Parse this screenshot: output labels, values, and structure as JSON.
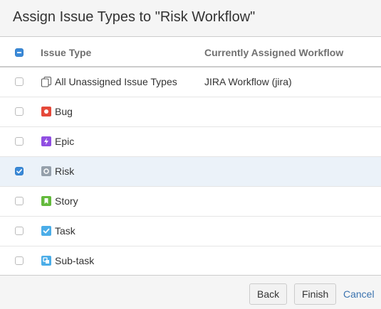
{
  "dialog": {
    "title": "Assign Issue Types to \"Risk Workflow\""
  },
  "table": {
    "headers": {
      "issue_type": "Issue Type",
      "workflow": "Currently Assigned Workflow"
    },
    "select_all_state": "indeterminate",
    "rows": [
      {
        "label": "All Unassigned Issue Types",
        "icon": "unassigned-icon",
        "workflow": "JIRA Workflow (jira)",
        "checked": false
      },
      {
        "label": "Bug",
        "icon": "bug-icon",
        "workflow": "",
        "checked": false,
        "color": "#e5493a"
      },
      {
        "label": "Epic",
        "icon": "epic-icon",
        "workflow": "",
        "checked": false,
        "color": "#904ee2"
      },
      {
        "label": "Risk",
        "icon": "risk-icon",
        "workflow": "",
        "checked": true,
        "color": "#95a0ab"
      },
      {
        "label": "Story",
        "icon": "story-icon",
        "workflow": "",
        "checked": false,
        "color": "#63ba3c"
      },
      {
        "label": "Task",
        "icon": "task-icon",
        "workflow": "",
        "checked": false,
        "color": "#4bade8"
      },
      {
        "label": "Sub-task",
        "icon": "subtask-icon",
        "workflow": "",
        "checked": false,
        "color": "#4bade8"
      }
    ]
  },
  "footer": {
    "back_label": "Back",
    "finish_label": "Finish",
    "cancel_label": "Cancel"
  },
  "colors": {
    "accent": "#3b8ad8",
    "link": "#3b73af",
    "selected_row": "#ebf2f9"
  }
}
